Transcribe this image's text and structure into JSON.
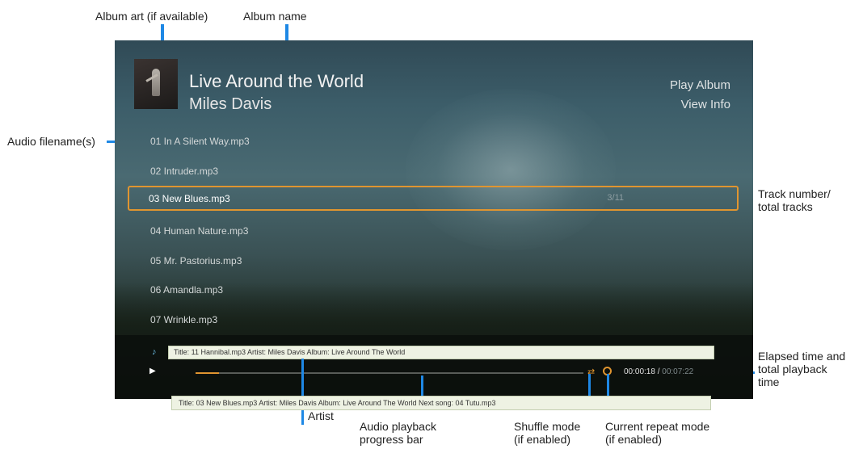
{
  "callouts": {
    "album_art": "Album art (if available)",
    "album_name": "Album name",
    "audio_filenames": "Audio filename(s)",
    "track_number_line1": "Track number/",
    "track_number_line2": "total tracks",
    "elapsed_line1": "Elapsed time and",
    "elapsed_line2": "total playback",
    "elapsed_line3": "time",
    "artist": "Artist",
    "progress_line1": "Audio playback",
    "progress_line2": "progress bar",
    "shuffle_line1": "Shuffle mode",
    "shuffle_line2": "(if enabled)",
    "repeat_line1": "Current repeat mode",
    "repeat_line2": "(if enabled)"
  },
  "player": {
    "album_name": "Live Around the World",
    "artist_name": "Miles Davis",
    "menu": {
      "play_album": "Play Album",
      "view_info": "View Info"
    },
    "tracks": [
      "01 In A Silent Way.mp3",
      "02 Intruder.mp3",
      "03 New Blues.mp3",
      "04 Human Nature.mp3",
      "05 Mr. Pastorius.mp3",
      "06 Amandla.mp3",
      "07 Wrinkle.mp3"
    ],
    "selected_track_count": "3/11",
    "now_playing_info": "Title: 11 Hannibal.mp3    Artist: Miles Davis    Album: Live Around The World",
    "elapsed": "00:00:18 / ",
    "total": "00:07:22",
    "progress": 0.06,
    "bottom_info": "Title: 03 New Blues.mp3    Artist: Miles Davis    Album: Live Around The World    Next song: 04 Tutu.mp3",
    "icons": [
      "music-note-icon",
      "play-icon",
      "shuffle-icon",
      "repeat-icon"
    ],
    "accent_color": "#e09530"
  }
}
